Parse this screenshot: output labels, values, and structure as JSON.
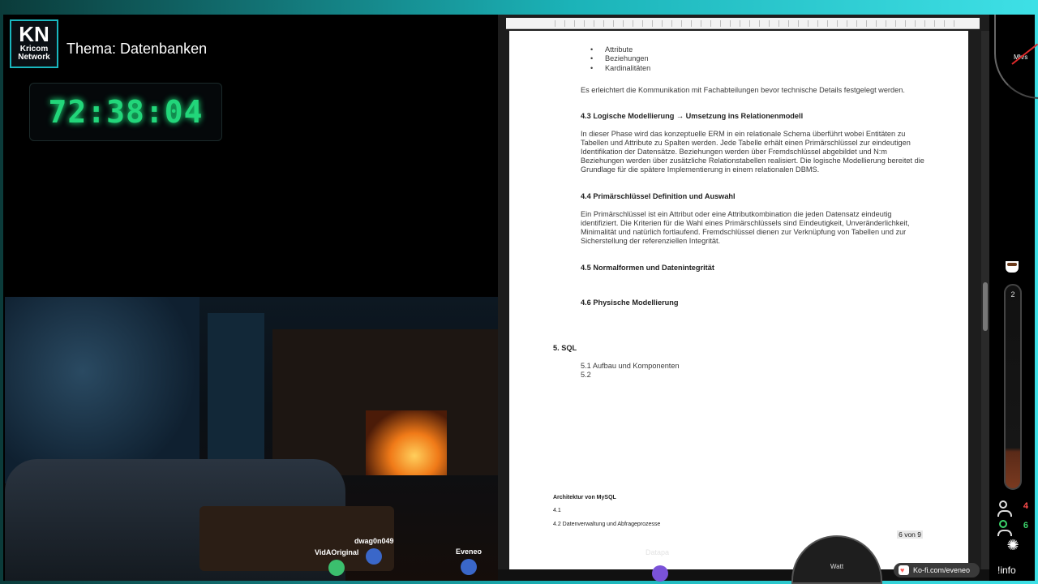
{
  "overlay": {
    "logo_big": "KN",
    "logo_line1": "Kricom",
    "logo_line2": "Network",
    "topic": "Thema: Datenbanken",
    "timer": "72:38:04",
    "viewers": [
      {
        "name": "VidAOriginal",
        "color": "#3bbf6e"
      },
      {
        "name": "dwag0n049",
        "color": "#3a67c9"
      },
      {
        "name": "Eveneo",
        "color": "#3a67c9"
      }
    ],
    "ghost_name": "Datapa",
    "watt_label": "Watt",
    "kofi_label": "Ko-fi.com/eveneo",
    "speed_label": "Mh/s",
    "tube_value": "2",
    "counter_red": "4",
    "counter_green": "6",
    "info_label": "!info"
  },
  "document": {
    "bullets": [
      "Attribute",
      "Beziehungen",
      "Kardinalitäten"
    ],
    "para_intro": "Es erleichtert die Kommunikation mit Fachabteilungen bevor technische Details festgelegt werden.",
    "h43": "4.3 Logische Modellierung → Umsetzung ins Relationenmodell",
    "p43": "In dieser Phase wird das konzeptuelle ERM in ein relationale Schema überführt wobei Entitäten zu Tabellen und Attribute zu Spalten werden. Jede Tabelle erhält einen Primärschlüssel zur eindeutigen Identifikation der Datensätze. Beziehungen werden über Fremdschlüssel abgebildet und N:m Beziehungen werden über zusätzliche Relationstabellen realisiert. Die logische Modellierung bereitet die Grundlage für die spätere Implementierung in einem relationalen DBMS.",
    "h44": "4.4 Primärschlüssel Definition und Auswahl",
    "p44": "Ein Primärschlüssel ist ein Attribut oder eine Attributkombination die jeden Datensatz eindeutig identifiziert. Die Kriterien für die Wahl eines Primärschlüssels sind Eindeutigkeit, Unveränderlichkeit, Minimalität und natürlich fortlaufend. Fremdschlüssel dienen zur Verknüpfung von Tabellen und zur Sicherstellung der referenziellen Integrität.",
    "h45": "4.5 Normalformen und Datenintegrität",
    "h46": "4.6 Physische Modellierung",
    "h5": "5. SQL",
    "s51": "5.1 Aufbau und Komponenten",
    "s52": "5.2",
    "f_title": "Architektur von MySQL",
    "f_41": "4.1",
    "f_42": "4.2 Datenverwaltung und Abfrageprozesse",
    "page_num": "6 von 9"
  }
}
